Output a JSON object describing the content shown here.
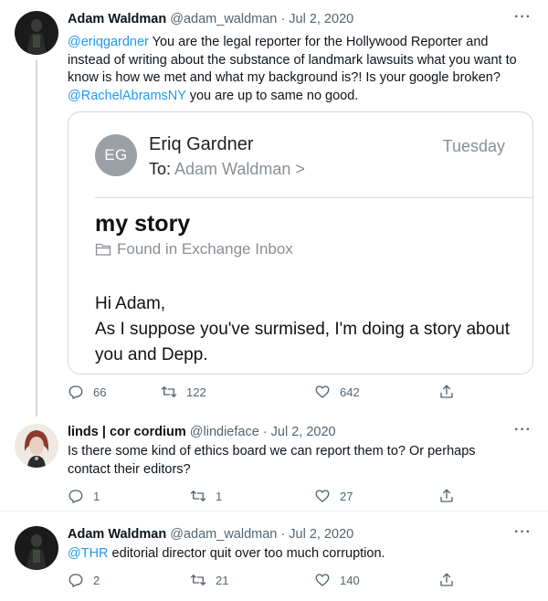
{
  "tweets": [
    {
      "name": "Adam Waldman",
      "handle": "@adam_waldman",
      "sep": " · ",
      "date": "Jul 2, 2020",
      "text_mention1": "@eriqgardner",
      "text_part1": " You are the legal reporter for the Hollywood Reporter and instead of writing about the substance of landmark lawsuits what you want to know is how we met and what my background is?! Is your google broken? ",
      "text_mention2": "@RachelAbramsNY",
      "text_part2": " you are up to same no good.",
      "replies": "66",
      "retweets": "122",
      "likes": "642"
    },
    {
      "name": "linds | cor cordium",
      "handle": "@lindieface",
      "sep": " · ",
      "date": "Jul 2, 2020",
      "text": "Is there some kind of ethics board we can report them to? Or perhaps contact their editors?",
      "replies": "1",
      "retweets": "1",
      "likes": "27"
    },
    {
      "name": "Adam Waldman",
      "handle": "@adam_waldman",
      "sep": " · ",
      "date": "Jul 2, 2020",
      "text_mention1": "@THR",
      "text_part1": " editorial director quit over too much corruption.",
      "replies": "2",
      "retweets": "21",
      "likes": "140"
    }
  ],
  "more_label": "···",
  "email_card": {
    "initials": "EG",
    "sender": "Eriq Gardner",
    "to_label": "To: ",
    "recipient": "Adam Waldman >",
    "day": "Tuesday",
    "subject": "my story",
    "folder": "Found in Exchange Inbox",
    "greeting": "Hi Adam,",
    "body": "As I suppose you've surmised, I'm doing a story about you and Depp."
  },
  "colors": {
    "link": "#1d9bf0",
    "muted": "#536471",
    "border": "#cfd9de"
  },
  "icons": [
    "reply-icon",
    "retweet-icon",
    "like-icon",
    "share-icon",
    "more-icon",
    "folder-icon"
  ]
}
